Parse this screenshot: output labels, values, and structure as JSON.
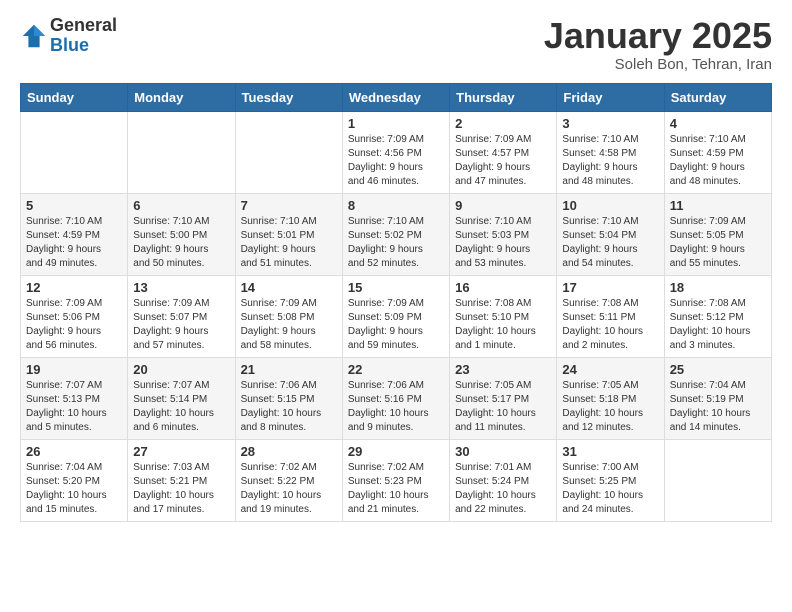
{
  "logo": {
    "general": "General",
    "blue": "Blue"
  },
  "title": "January 2025",
  "subtitle": "Soleh Bon, Tehran, Iran",
  "days_header": [
    "Sunday",
    "Monday",
    "Tuesday",
    "Wednesday",
    "Thursday",
    "Friday",
    "Saturday"
  ],
  "weeks": [
    [
      {
        "day": "",
        "info": ""
      },
      {
        "day": "",
        "info": ""
      },
      {
        "day": "",
        "info": ""
      },
      {
        "day": "1",
        "info": "Sunrise: 7:09 AM\nSunset: 4:56 PM\nDaylight: 9 hours\nand 46 minutes."
      },
      {
        "day": "2",
        "info": "Sunrise: 7:09 AM\nSunset: 4:57 PM\nDaylight: 9 hours\nand 47 minutes."
      },
      {
        "day": "3",
        "info": "Sunrise: 7:10 AM\nSunset: 4:58 PM\nDaylight: 9 hours\nand 48 minutes."
      },
      {
        "day": "4",
        "info": "Sunrise: 7:10 AM\nSunset: 4:59 PM\nDaylight: 9 hours\nand 48 minutes."
      }
    ],
    [
      {
        "day": "5",
        "info": "Sunrise: 7:10 AM\nSunset: 4:59 PM\nDaylight: 9 hours\nand 49 minutes."
      },
      {
        "day": "6",
        "info": "Sunrise: 7:10 AM\nSunset: 5:00 PM\nDaylight: 9 hours\nand 50 minutes."
      },
      {
        "day": "7",
        "info": "Sunrise: 7:10 AM\nSunset: 5:01 PM\nDaylight: 9 hours\nand 51 minutes."
      },
      {
        "day": "8",
        "info": "Sunrise: 7:10 AM\nSunset: 5:02 PM\nDaylight: 9 hours\nand 52 minutes."
      },
      {
        "day": "9",
        "info": "Sunrise: 7:10 AM\nSunset: 5:03 PM\nDaylight: 9 hours\nand 53 minutes."
      },
      {
        "day": "10",
        "info": "Sunrise: 7:10 AM\nSunset: 5:04 PM\nDaylight: 9 hours\nand 54 minutes."
      },
      {
        "day": "11",
        "info": "Sunrise: 7:09 AM\nSunset: 5:05 PM\nDaylight: 9 hours\nand 55 minutes."
      }
    ],
    [
      {
        "day": "12",
        "info": "Sunrise: 7:09 AM\nSunset: 5:06 PM\nDaylight: 9 hours\nand 56 minutes."
      },
      {
        "day": "13",
        "info": "Sunrise: 7:09 AM\nSunset: 5:07 PM\nDaylight: 9 hours\nand 57 minutes."
      },
      {
        "day": "14",
        "info": "Sunrise: 7:09 AM\nSunset: 5:08 PM\nDaylight: 9 hours\nand 58 minutes."
      },
      {
        "day": "15",
        "info": "Sunrise: 7:09 AM\nSunset: 5:09 PM\nDaylight: 9 hours\nand 59 minutes."
      },
      {
        "day": "16",
        "info": "Sunrise: 7:08 AM\nSunset: 5:10 PM\nDaylight: 10 hours\nand 1 minute."
      },
      {
        "day": "17",
        "info": "Sunrise: 7:08 AM\nSunset: 5:11 PM\nDaylight: 10 hours\nand 2 minutes."
      },
      {
        "day": "18",
        "info": "Sunrise: 7:08 AM\nSunset: 5:12 PM\nDaylight: 10 hours\nand 3 minutes."
      }
    ],
    [
      {
        "day": "19",
        "info": "Sunrise: 7:07 AM\nSunset: 5:13 PM\nDaylight: 10 hours\nand 5 minutes."
      },
      {
        "day": "20",
        "info": "Sunrise: 7:07 AM\nSunset: 5:14 PM\nDaylight: 10 hours\nand 6 minutes."
      },
      {
        "day": "21",
        "info": "Sunrise: 7:06 AM\nSunset: 5:15 PM\nDaylight: 10 hours\nand 8 minutes."
      },
      {
        "day": "22",
        "info": "Sunrise: 7:06 AM\nSunset: 5:16 PM\nDaylight: 10 hours\nand 9 minutes."
      },
      {
        "day": "23",
        "info": "Sunrise: 7:05 AM\nSunset: 5:17 PM\nDaylight: 10 hours\nand 11 minutes."
      },
      {
        "day": "24",
        "info": "Sunrise: 7:05 AM\nSunset: 5:18 PM\nDaylight: 10 hours\nand 12 minutes."
      },
      {
        "day": "25",
        "info": "Sunrise: 7:04 AM\nSunset: 5:19 PM\nDaylight: 10 hours\nand 14 minutes."
      }
    ],
    [
      {
        "day": "26",
        "info": "Sunrise: 7:04 AM\nSunset: 5:20 PM\nDaylight: 10 hours\nand 15 minutes."
      },
      {
        "day": "27",
        "info": "Sunrise: 7:03 AM\nSunset: 5:21 PM\nDaylight: 10 hours\nand 17 minutes."
      },
      {
        "day": "28",
        "info": "Sunrise: 7:02 AM\nSunset: 5:22 PM\nDaylight: 10 hours\nand 19 minutes."
      },
      {
        "day": "29",
        "info": "Sunrise: 7:02 AM\nSunset: 5:23 PM\nDaylight: 10 hours\nand 21 minutes."
      },
      {
        "day": "30",
        "info": "Sunrise: 7:01 AM\nSunset: 5:24 PM\nDaylight: 10 hours\nand 22 minutes."
      },
      {
        "day": "31",
        "info": "Sunrise: 7:00 AM\nSunset: 5:25 PM\nDaylight: 10 hours\nand 24 minutes."
      },
      {
        "day": "",
        "info": ""
      }
    ]
  ]
}
